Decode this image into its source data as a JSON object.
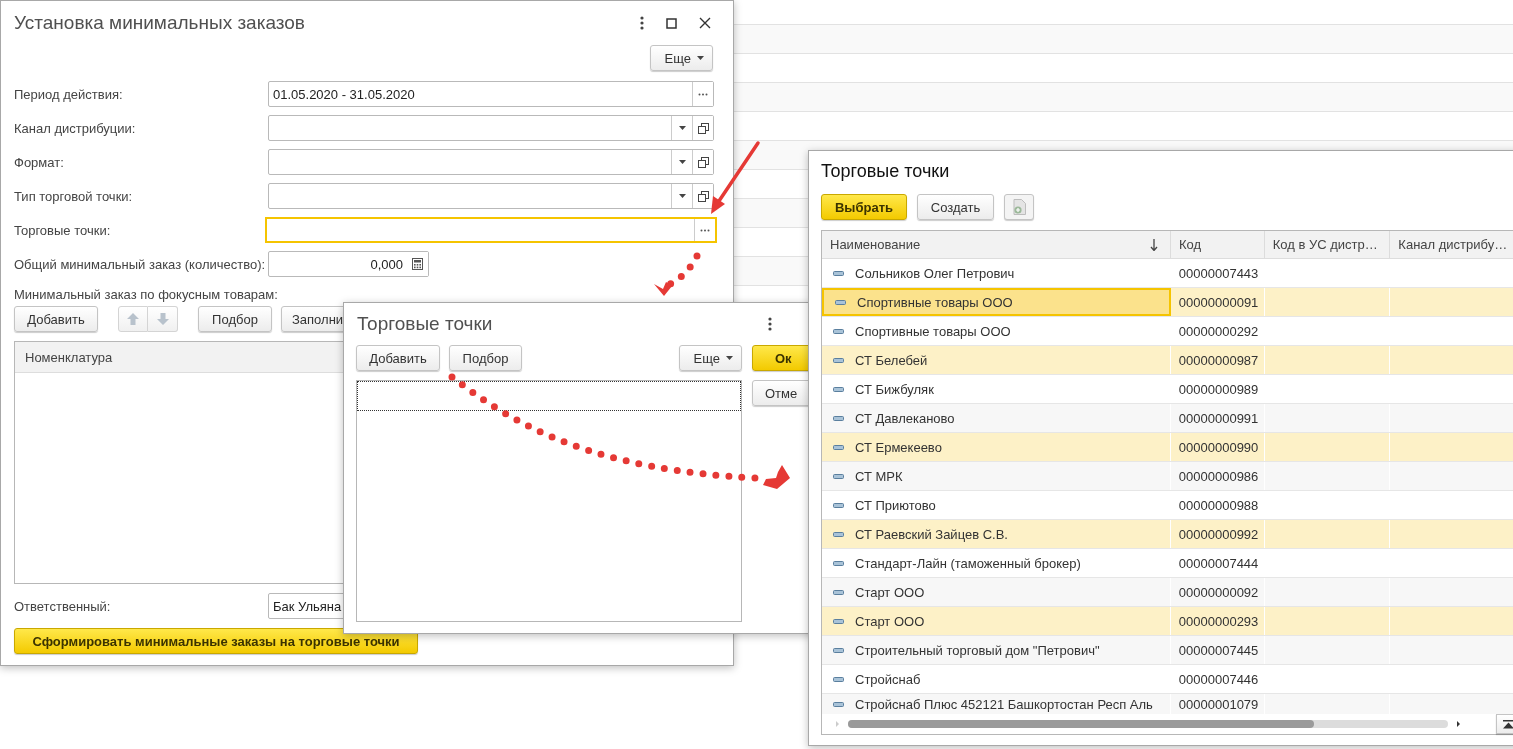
{
  "main_window": {
    "title": "Установка минимальных заказов",
    "more_button": "Еще",
    "fields": [
      {
        "label": "Период действия:",
        "kind": "period",
        "value": "01.05.2020 - 31.05.2020",
        "focused": false
      },
      {
        "label": "Канал дистрибуции:",
        "kind": "select",
        "focused": false
      },
      {
        "label": "Формат:",
        "kind": "select",
        "focused": false
      },
      {
        "label": "Тип торговой точки:",
        "kind": "select",
        "focused": false
      },
      {
        "label": "Торговые точки:",
        "kind": "choice",
        "focused": true
      },
      {
        "label": "Общий минимальный заказ (количество):",
        "kind": "number",
        "value": "0,000",
        "focused": false
      }
    ],
    "section_label": "Минимальный заказ по фокусным товарам:",
    "toolbar": [
      {
        "kind": "button",
        "label": "Добавить"
      },
      {
        "kind": "move"
      },
      {
        "kind": "button",
        "label": "Подбор"
      },
      {
        "kind": "button",
        "label": "Заполни"
      }
    ],
    "table": {
      "columns": [
        "Номенклатура"
      ]
    },
    "responsible": {
      "label": "Ответственный:",
      "value": "Бак Ульяна"
    },
    "submit_button": "Сформировать минимальные заказы на торговые точки"
  },
  "list_window": {
    "title": "Торговые точки",
    "buttons": [
      "Добавить",
      "Подбор"
    ],
    "more_button": "Еще",
    "ok_button": "Ок",
    "cancel_button": "Отме"
  },
  "picker_window": {
    "title": "Торговые точки",
    "select_button": "Выбрать",
    "create_button": "Создать",
    "columns": [
      {
        "label": "Наименование",
        "sorted": true
      },
      {
        "label": "Код",
        "sorted": false
      },
      {
        "label": "Код в УС дистр…",
        "sorted": false
      },
      {
        "label": "Канал дистрибу…",
        "sorted": false
      }
    ],
    "rows": [
      {
        "name": "Сольников Олег Петрович",
        "code": "00000007443",
        "selected": false,
        "current": false
      },
      {
        "name": "Спортивные товары ООО",
        "code": "00000000091",
        "selected": true,
        "current": true
      },
      {
        "name": "Спортивные товары ООО",
        "code": "00000000292",
        "selected": false,
        "current": false
      },
      {
        "name": "СТ Белебей",
        "code": "00000000987",
        "selected": true,
        "current": false
      },
      {
        "name": "СТ Бижбуляк",
        "code": "00000000989",
        "selected": false,
        "current": false
      },
      {
        "name": "СТ Давлеканово",
        "code": "00000000991",
        "selected": false,
        "current": false
      },
      {
        "name": "СТ Ермекеево",
        "code": "00000000990",
        "selected": true,
        "current": false
      },
      {
        "name": "СТ МРК",
        "code": "00000000986",
        "selected": false,
        "current": false
      },
      {
        "name": "СТ Приютово",
        "code": "00000000988",
        "selected": false,
        "current": false
      },
      {
        "name": "СТ Раевский Зайцев С.В.",
        "code": "00000000992",
        "selected": true,
        "current": false
      },
      {
        "name": "Стандарт-Лайн (таможенный брокер)",
        "code": "00000007444",
        "selected": false,
        "current": false
      },
      {
        "name": "Старт ООО",
        "code": "00000000092",
        "selected": false,
        "current": false
      },
      {
        "name": "Старт ООО",
        "code": "00000000293",
        "selected": true,
        "current": false
      },
      {
        "name": "Строительный торговый дом \"Петрович\"",
        "code": "00000007445",
        "selected": false,
        "current": false
      },
      {
        "name": "Стройснаб",
        "code": "00000007446",
        "selected": false,
        "current": false
      },
      {
        "name": "Стройснаб Плюс 452121 Башкортостан Респ Аль",
        "code": "00000001079",
        "selected": false,
        "current": false
      }
    ]
  }
}
